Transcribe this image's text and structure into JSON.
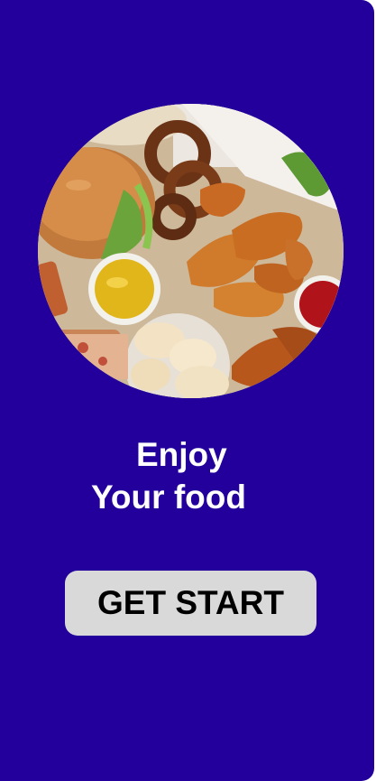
{
  "hero": {
    "image_name": "fast-food-platter-image"
  },
  "headline": {
    "line1": "Enjoy",
    "line2": "Your food"
  },
  "cta": {
    "label": "GET START"
  },
  "colors": {
    "background": "#23009c",
    "text": "#ffffff",
    "button_bg": "#d9d9d9",
    "button_text": "#000000"
  }
}
